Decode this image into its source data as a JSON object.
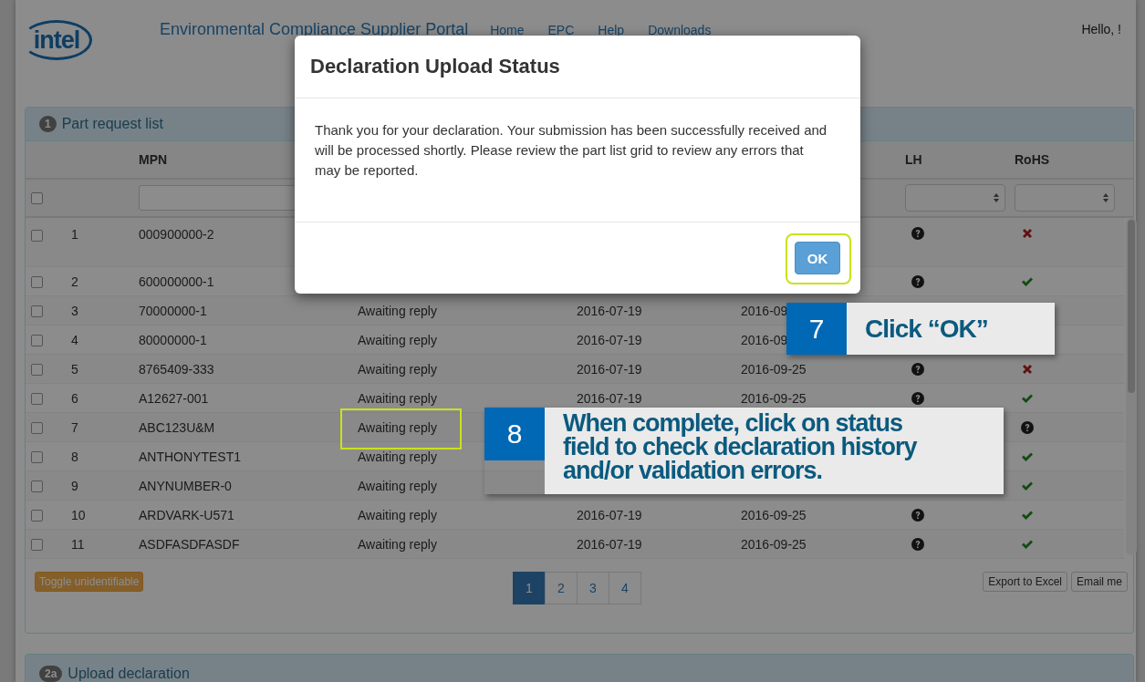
{
  "header": {
    "logo": "intel",
    "title": "Environmental Compliance Supplier Portal",
    "nav": [
      {
        "label": "Home"
      },
      {
        "label": "EPC"
      },
      {
        "label": "Help"
      },
      {
        "label": "Downloads"
      }
    ],
    "greeting": "Hello, !"
  },
  "part_request_panel": {
    "badge": "1",
    "title": "Part request list",
    "column_headers": {
      "mpn": "MPN",
      "lh": "LH",
      "rohs": "RoHS"
    },
    "select_all_checked": false,
    "rows": [
      {
        "number": "1",
        "mpn": "000900000-2",
        "checked": false,
        "highlighted": false,
        "lh": {
          "kind": "question"
        },
        "rohs": {
          "kind": "cross"
        }
      },
      {
        "number": "2",
        "mpn": "600000000-1",
        "checked": false,
        "highlighted": false,
        "lh": {
          "kind": "question"
        },
        "rohs": {
          "kind": "check"
        }
      },
      {
        "number": "3",
        "mpn": "70000000-1",
        "checked": false,
        "highlighted": false,
        "status": "Awaiting reply",
        "requested": "2016-07-19",
        "due": "2016-09"
      },
      {
        "number": "4",
        "mpn": "80000000-1",
        "checked": false,
        "highlighted": false,
        "status": "Awaiting reply",
        "requested": "2016-07-19",
        "due": "2016-09"
      },
      {
        "number": "5",
        "mpn": "8765409-333",
        "checked": false,
        "highlighted": false,
        "status": "Awaiting reply",
        "requested": "2016-07-19",
        "due": "2016-09-25",
        "lh": {
          "kind": "question"
        },
        "rohs": {
          "kind": "cross"
        }
      },
      {
        "number": "6",
        "mpn": "A12627-001",
        "checked": false,
        "highlighted": false,
        "status": "Awaiting reply",
        "requested": "2016-07-19",
        "due": "2016-09-25",
        "lh": {
          "kind": "question"
        },
        "rohs": {
          "kind": "check"
        }
      },
      {
        "number": "7",
        "mpn": "ABC123U&M",
        "checked": false,
        "highlighted": true,
        "status": "Awaiting reply",
        "rohs": {
          "kind": "question"
        }
      },
      {
        "number": "8",
        "mpn": "ANTHONYTEST1",
        "checked": false,
        "highlighted": false,
        "status": "Awaiting reply",
        "rohs": {
          "kind": "check"
        }
      },
      {
        "number": "9",
        "mpn": "ANYNUMBER-0",
        "checked": false,
        "highlighted": false,
        "status": "Awaiting reply",
        "rohs": {
          "kind": "check"
        }
      },
      {
        "number": "10",
        "mpn": "ARDVARK-U571",
        "checked": false,
        "highlighted": false,
        "status": "Awaiting reply",
        "requested": "2016-07-19",
        "due": "2016-09-25",
        "lh": {
          "kind": "question"
        },
        "rohs": {
          "kind": "check"
        }
      },
      {
        "number": "11",
        "mpn": "ASDFASDFASDF",
        "checked": false,
        "highlighted": false,
        "status": "Awaiting reply",
        "requested": "2016-07-19",
        "due": "2016-09-25",
        "lh": {
          "kind": "question"
        },
        "rohs": {
          "kind": "check"
        }
      }
    ],
    "toggle_button": "Toggle unidentifiable",
    "pages": [
      {
        "label": "1",
        "selected": true
      },
      {
        "label": "2",
        "selected": false
      },
      {
        "label": "3",
        "selected": false
      },
      {
        "label": "4",
        "selected": false
      }
    ],
    "export_button": "Export to Excel",
    "email_button": "Email me"
  },
  "upload_panel": {
    "badge": "2a",
    "title": "Upload declaration"
  },
  "modal": {
    "title": "Declaration Upload Status",
    "message": "Thank you for your declaration. Your submission has been successfully received and will be processed shortly. Please review the part list grid to review any errors that may be reported.",
    "ok_button": "OK",
    "ok_highlighted": true
  },
  "callouts": [
    {
      "number": "7",
      "text": "Click “OK”"
    },
    {
      "number": "8",
      "text": "When complete, click on status field to check declaration history and/or validation errors."
    }
  ]
}
